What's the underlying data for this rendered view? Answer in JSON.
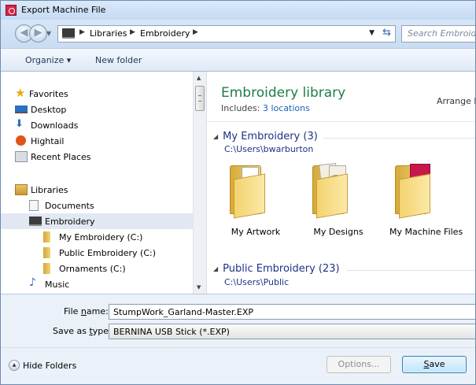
{
  "window": {
    "title": "Export Machine File"
  },
  "address": {
    "crumbs": [
      "Libraries",
      "Embroidery"
    ],
    "search_placeholder": "Search Embroidery"
  },
  "toolbar": {
    "organize_label": "Organize ▾",
    "new_folder_label": "New folder"
  },
  "sidebar": {
    "favorites": {
      "label": "Favorites",
      "items": [
        "Desktop",
        "Downloads",
        "Hightail",
        "Recent Places"
      ]
    },
    "libraries": {
      "label": "Libraries",
      "items": [
        "Documents",
        "Embroidery"
      ],
      "subitems": [
        "My Embroidery (C:)",
        "Public Embroidery (C:)",
        "Ornaments (C:)"
      ],
      "after": [
        "Music"
      ]
    },
    "selected": "Embroidery"
  },
  "main": {
    "title": "Embroidery library",
    "includes_label": "Includes:",
    "includes_link": "3 locations",
    "arrange_label": "Arrange by",
    "groups": [
      {
        "name": "My Embroidery (3)",
        "path": "C:\\Users\\bwarburton",
        "folders": [
          "My Artwork",
          "My Designs",
          "My Machine Files"
        ]
      },
      {
        "name": "Public Embroidery (23)",
        "path": "C:\\Users\\Public"
      }
    ]
  },
  "form": {
    "filename_label_pre": "File ",
    "filename_label_u": "n",
    "filename_label_post": "ame:",
    "filename_value": "StumpWork_Garland-Master.EXP",
    "savetype_label_pre": "Save as ",
    "savetype_label_u": "t",
    "savetype_label_post": "ype:",
    "savetype_value": "BERNINA USB Stick (*.EXP)"
  },
  "footer": {
    "hide_folders_label": "Hide Folders",
    "options_label": "Options...",
    "save_label_u": "S",
    "save_label_post": "ave"
  },
  "colors": {
    "title_green": "#1e7d45",
    "link_blue": "#1a62b8",
    "group_blue": "#1e3287"
  },
  "icons": {
    "favorites": "star-icon",
    "desktop": "desktop-icon",
    "downloads": "downloads-icon",
    "hightail": "hightail-icon",
    "recent": "recent-places-icon",
    "libraries": "libraries-icon",
    "documents": "document-icon",
    "embroidery": "embroidery-library-icon",
    "folder": "folder-icon",
    "music": "music-icon"
  }
}
